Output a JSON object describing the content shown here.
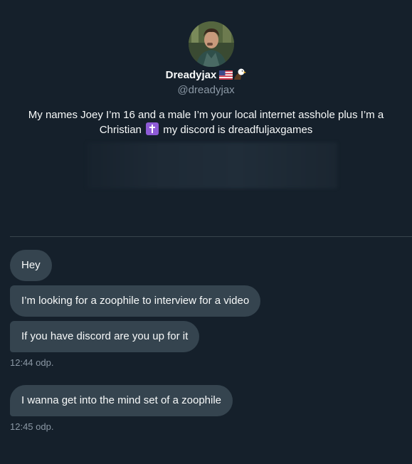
{
  "profile": {
    "display_name": "Dreadyjax",
    "handle": "@dreadyjax",
    "bio_part1": "My names Joey I’m 16 and a male I’m your local internet asshole plus I’m a Christian",
    "bio_part2": "my discord is dreadfuljaxgames",
    "name_icons": [
      "us-flag-icon",
      "eagle-icon"
    ],
    "bio_icon": "latin-cross-icon"
  },
  "messages": [
    {
      "text": "Hey"
    },
    {
      "text": "I’m looking for a zoophile to interview for a video"
    },
    {
      "text": "If you have discord are you up for it"
    },
    {
      "text": "I wanna get into the mind set of a zoophile"
    }
  ],
  "timestamps": [
    "12:44 odp.",
    "12:45 odp."
  ],
  "colors": {
    "background": "#15202b",
    "bubble": "#35444f",
    "secondary_text": "#8b98a5",
    "divider": "#38444d"
  }
}
